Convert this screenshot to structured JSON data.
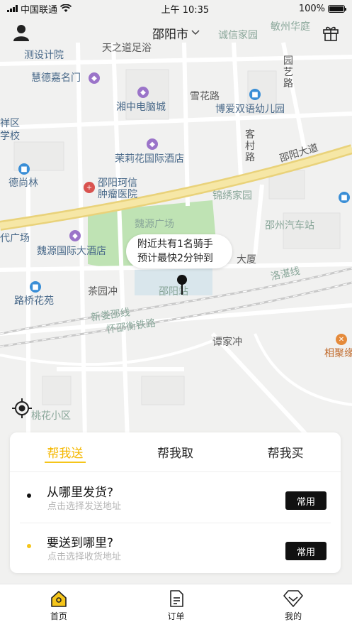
{
  "status_bar": {
    "carrier": "中国联通",
    "time": "上午 10:35",
    "battery": "100%"
  },
  "header": {
    "city": "邵阳市",
    "city_chevron": "chevron-down-icon",
    "left_icon": "user-icon",
    "right_icon": "gift-icon"
  },
  "map": {
    "labels": [
      {
        "text": "测设计院",
        "style": "blue"
      },
      {
        "text": "天之道足浴",
        "style": "dark"
      },
      {
        "text": "诚信家园",
        "style": "teal"
      },
      {
        "text": "敏州华庭",
        "style": "teal"
      },
      {
        "text": "慧德嘉名门",
        "style": "blue"
      },
      {
        "text": "园艺路",
        "style": "road"
      },
      {
        "text": "雪花路",
        "style": "road"
      },
      {
        "text": "湘中电脑城",
        "style": "blue"
      },
      {
        "text": "博爱双语幼儿园",
        "style": "blue"
      },
      {
        "text": "祥区",
        "style": "blue"
      },
      {
        "text": "学校",
        "style": "blue"
      },
      {
        "text": "客村路",
        "style": "road"
      },
      {
        "text": "茉莉花国际酒店",
        "style": "blue"
      },
      {
        "text": "邵阳大道",
        "style": "road"
      },
      {
        "text": "德尚林",
        "style": "blue"
      },
      {
        "text": "邵阳珂信",
        "style": "blue"
      },
      {
        "text": "肿瘤医院",
        "style": "blue"
      },
      {
        "text": "锦绣家园",
        "style": "teal"
      },
      {
        "text": "魏源广场",
        "style": "teal"
      },
      {
        "text": "邵州汽车站",
        "style": "teal"
      },
      {
        "text": "代广场",
        "style": "blue"
      },
      {
        "text": "魏源国际大酒店",
        "style": "blue"
      },
      {
        "text": "大厦",
        "style": "dark"
      },
      {
        "text": "洛湛线",
        "style": "teal"
      },
      {
        "text": "路桥花苑",
        "style": "blue"
      },
      {
        "text": "茶园冲",
        "style": "dark"
      },
      {
        "text": "邵阳站",
        "style": "teal"
      },
      {
        "text": "新娄邵线",
        "style": "teal"
      },
      {
        "text": "怀邵衡铁路",
        "style": "teal"
      },
      {
        "text": "谭家冲",
        "style": "dark"
      },
      {
        "text": "相聚缘",
        "style": "orange"
      },
      {
        "text": "桃花小区",
        "style": "teal"
      }
    ]
  },
  "bubble": {
    "line1": "附近共有1名骑手",
    "line2": "预计最快2分钟到"
  },
  "pin_icon": "location-pin-icon",
  "locate_icon": "locate-icon",
  "card": {
    "tabs": [
      {
        "label": "帮我送",
        "active": true
      },
      {
        "label": "帮我取",
        "active": false
      },
      {
        "label": "帮我买",
        "active": false
      }
    ],
    "from": {
      "title": "从哪里发货?",
      "subtitle": "点击选择发送地址",
      "button": "常用",
      "dot_color": "#111111"
    },
    "to": {
      "title": "要送到哪里?",
      "subtitle": "点击选择收货地址",
      "button": "常用",
      "dot_color": "#f5c51a"
    }
  },
  "bottom_nav": [
    {
      "label": "首页",
      "icon": "home-icon",
      "active": true
    },
    {
      "label": "订单",
      "icon": "order-icon",
      "active": false
    },
    {
      "label": "我的",
      "icon": "profile-diamond-icon",
      "active": false
    }
  ],
  "colors": {
    "accent": "#f5c51a",
    "active_tab_text": "#f5b800",
    "button_bg": "#111111"
  }
}
